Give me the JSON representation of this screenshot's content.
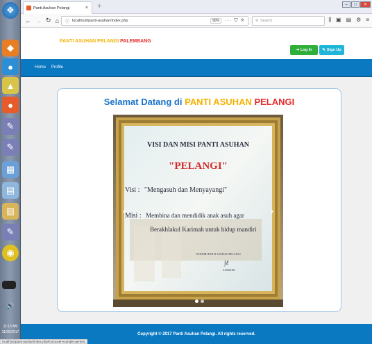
{
  "browser": {
    "tab_title": "Panti Asuhan Pelangi",
    "tab_close": "×",
    "new_tab": "+",
    "url": "localhost/panti-asuhan/index.php",
    "zoom": "90%",
    "search_placeholder": "Search",
    "status_url": "localhost/panti-asuhan/index.php#carousel-example-generic"
  },
  "taskbar": {
    "time": "11:13 AM",
    "date": "11/26/2017"
  },
  "site": {
    "brand_part1": "PANTI ASUHAN PELANGI",
    "brand_part2": "PALEMBANG",
    "login_label": "Log In",
    "signup_label": "Sign Up",
    "menu": [
      "Home",
      "Profile"
    ],
    "welcome_prefix": "Selamat Datang di",
    "welcome_part1": "PANTI ASUHAN",
    "welcome_part2": "PELANGI",
    "footer": "Copyright © 2017 Panti Asuhan Pelangi. All rights reserved."
  },
  "slide": {
    "heading": "VISI DAN MISI PANTI ASUHAN",
    "name": "\"PELANGI\"",
    "visi_label": "Visi",
    "visi_text": "\"Mengasuh dan Menyayangi\"",
    "misi_label": "Misi",
    "misi_line1": "Membina dan mendidik anak asuh agar",
    "misi_line2": "Berakhlakul Karimah untuk hidup mandiri",
    "founder_label": "PENDIRI PANTI ASUHAN PELANGI",
    "founder_name": "SAMSURI"
  },
  "colors": {
    "brand_blue": "#0b79c2",
    "brand_yellow": "#f4b100",
    "brand_red": "#e52b2b",
    "login_green": "#2fae3b",
    "signup_cyan": "#1fb5d9"
  }
}
